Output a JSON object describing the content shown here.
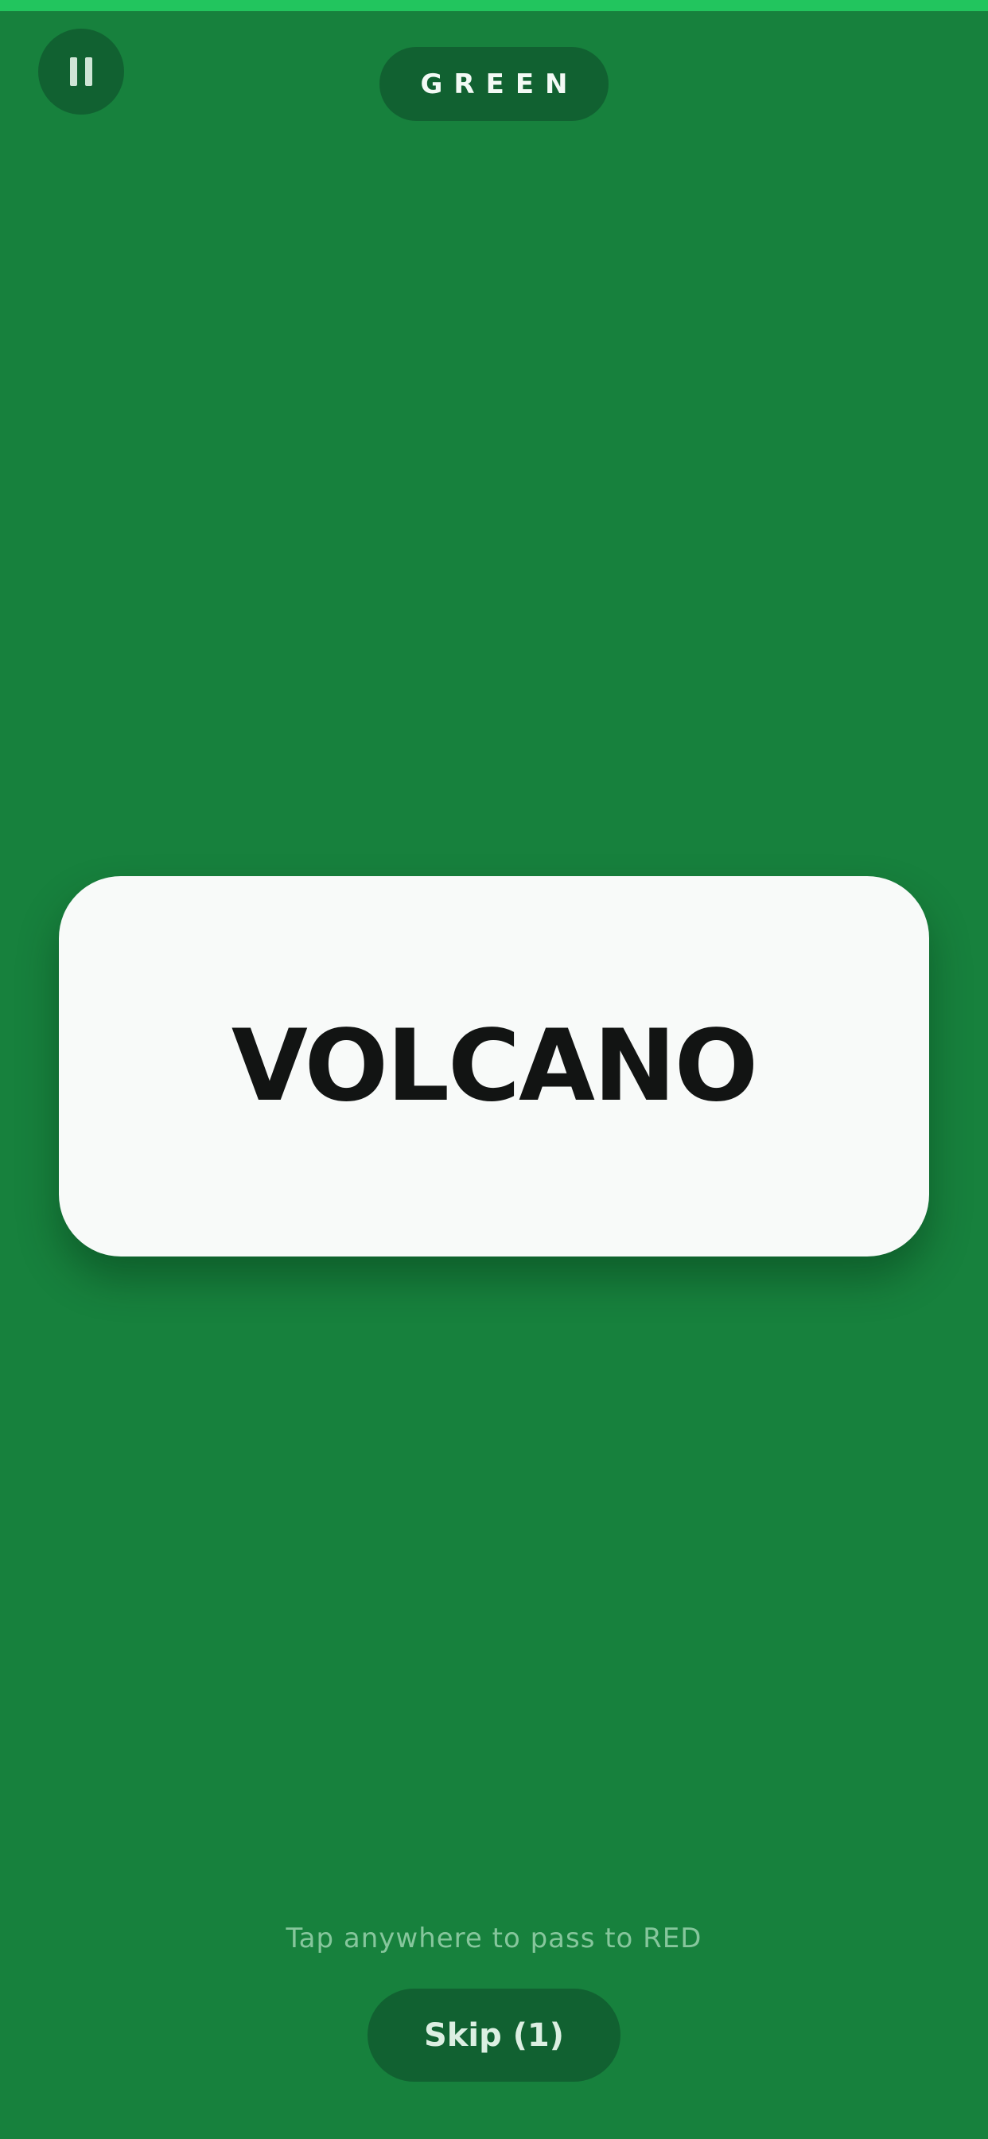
{
  "theme": {
    "background": "#17813d",
    "top_bar": "#22c55e",
    "pill": "#116131",
    "card": "#f8faf9",
    "word_color": "#121413"
  },
  "header": {
    "pause_icon": "pause-icon",
    "team_label": "GREEN"
  },
  "card": {
    "word": "VOLCANO"
  },
  "footer": {
    "hint": "Tap anywhere to pass to RED",
    "skip_label": "Skip (1)"
  }
}
